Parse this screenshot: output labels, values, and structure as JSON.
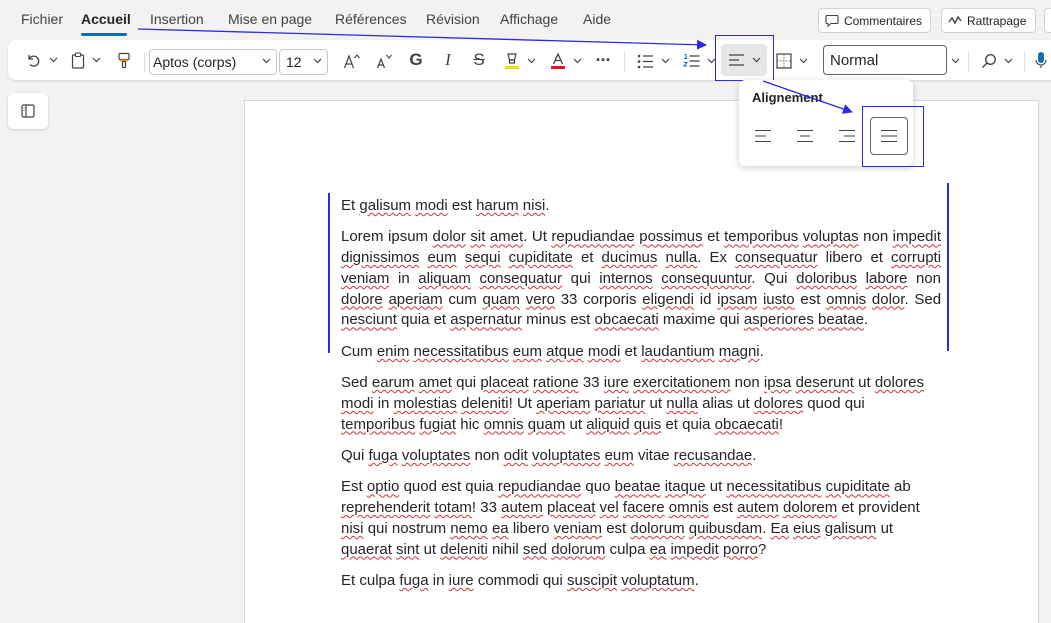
{
  "menu": {
    "items": [
      "Fichier",
      "Accueil",
      "Insertion",
      "Mise en page",
      "Références",
      "Révision",
      "Affichage",
      "Aide"
    ],
    "active": "Accueil",
    "comments_label": "Commentaires",
    "catchup_label": "Rattrapage"
  },
  "ribbon": {
    "font_name": "Aptos (corps)",
    "font_size": "12",
    "style_name": "Normal",
    "icons": [
      "undo-icon",
      "clipboard-icon",
      "format-painter-icon",
      "grow-font-icon",
      "shrink-font-icon",
      "bold-icon",
      "italic-icon",
      "strikethrough-icon",
      "highlight-icon",
      "font-color-icon",
      "more-icon",
      "bullets-icon",
      "numbering-icon",
      "align-icon",
      "borders-icon",
      "find-icon",
      "dictate-icon"
    ],
    "bold_glyph": "G",
    "italic_glyph": "I",
    "strike_glyph": "S",
    "more_glyph": "···"
  },
  "alignment_popup": {
    "title": "Alignement",
    "options": [
      "align-left",
      "align-center",
      "align-right",
      "justify"
    ],
    "selected": "justify"
  },
  "colors": {
    "accent": "#0f6cbd",
    "annotation": "#2a2ae6",
    "squiggle": "#d13438",
    "font_color_bar": "#e81123",
    "highlight_bar": "#ffd700"
  },
  "document": {
    "paragraphs": [
      "Et galisum modi est harum nisi.",
      "Lorem ipsum dolor sit amet. Ut repudiandae possimus et temporibus voluptas non impedit dignissimos eum sequi cupiditate et ducimus nulla. Ex consequatur libero et corrupti veniam in aliquam consequatur qui internos consequuntur. Qui doloribus labore non dolore aperiam cum quam vero 33 corporis eligendi id ipsam iusto est omnis dolor. Sed nesciunt quia et aspernatur minus est obcaecati maxime qui asperiores beatae.",
      "Cum enim necessitatibus eum atque modi et laudantium magni.",
      "Sed earum amet qui placeat ratione 33 iure exercitationem non ipsa deserunt ut dolores modi in molestias deleniti! Ut aperiam pariatur ut nulla alias ut dolores quod qui temporibus fugiat hic omnis quam ut aliquid quis et quia obcaecati!",
      "Qui fuga voluptates non odit voluptates eum vitae recusandae.",
      "Est optio quod est quia repudiandae quo beatae itaque ut necessitatibus cupiditate ab reprehenderit totam! 33 autem placeat vel facere omnis est autem dolorem et provident nisi qui nostrum nemo ea libero veniam est dolorum quibusdam. Ea eius galisum ut quaerat sint ut deleniti nihil sed dolorum culpa ea impedit porro?",
      "Et culpa fuga in iure commodi qui suscipit voluptatum."
    ],
    "misspelled": [
      "galisum",
      "modi",
      "harum",
      "dolor",
      "sit",
      "amet",
      "repudiandae",
      "possimus",
      "temporibus",
      "voluptas",
      "impedit",
      "dignissimos",
      "eum",
      "sequi",
      "cupiditate",
      "ducimus",
      "nulla",
      "consequatur",
      "corrupti",
      "veniam",
      "aliquam",
      "internos",
      "consequuntur",
      "doloribus",
      "labore",
      "dolore",
      "aperiam",
      "quam",
      "vero",
      "eligendi",
      "ipsam",
      "iusto",
      "omnis",
      "nesciunt",
      "aspernatur",
      "obcaecati",
      "asperiores",
      "beatae",
      "enim",
      "necessitatibus",
      "atque",
      "laudantium",
      "magni",
      "earum",
      "placeat",
      "ratione",
      "iure",
      "exercitationem",
      "ipsa",
      "deserunt",
      "dolores",
      "molestias",
      "deleniti",
      "pariatur",
      "fugiat",
      "aliquid",
      "quis",
      "fuga",
      "voluptates",
      "odit",
      "recusandae",
      "optio",
      "itaque",
      "reprehenderit",
      "totam",
      "autem",
      "vel",
      "facere",
      "dolorem",
      "nisi",
      "nemo",
      "ea",
      "quibusdam",
      "Ea",
      "eius",
      "quaerat",
      "sint",
      "sed",
      "dolorum",
      "porro",
      "suscipit",
      "voluptatum"
    ]
  }
}
